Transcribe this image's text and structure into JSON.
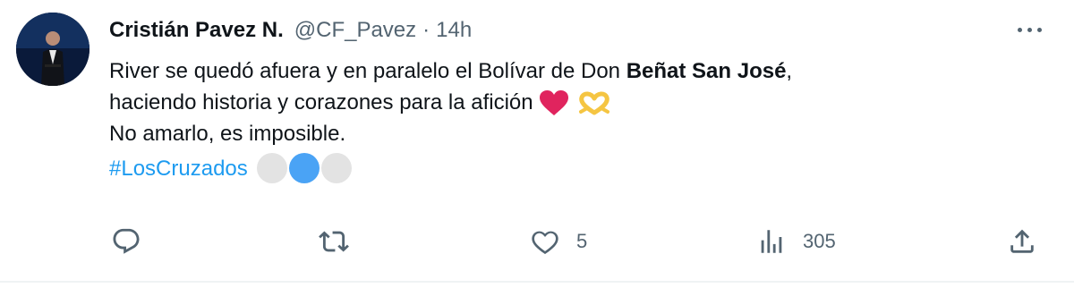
{
  "author": {
    "name": "Cristián Pavez N.",
    "handle": "@CF_Pavez",
    "separator": "·",
    "time": "14h"
  },
  "tweet": {
    "line1_pre": "River se quedó afuera y en paralelo el Bolívar de Don ",
    "line1_bold": "Beñat San José",
    "line1_post": ",",
    "line2": "haciendo historia y corazones para la afición",
    "line3": "No amarlo, es imposible.",
    "hashtag": "#LosCruzados"
  },
  "actions": {
    "reply_icon": "reply-icon",
    "retweet_icon": "retweet-icon",
    "like_icon": "heart-icon",
    "like_count": "5",
    "views_icon": "analytics-icon",
    "views_count": "305",
    "share_icon": "share-icon"
  },
  "colors": {
    "text": "#0f1419",
    "secondary": "#536471",
    "link": "#1d9bf0",
    "heart": "#e0245e"
  }
}
